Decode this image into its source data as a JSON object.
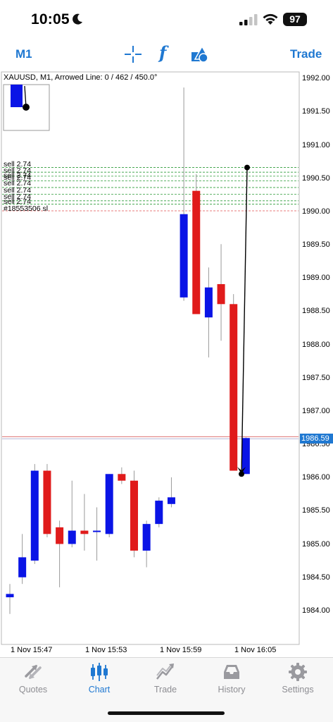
{
  "status_bar": {
    "time": "10:05",
    "battery": "97"
  },
  "toolbar": {
    "timeframe": "M1",
    "indicator_symbol": "f",
    "trade_label": "Trade",
    "icons": [
      "crosshair-icon",
      "indicators-icon",
      "objects-icon"
    ]
  },
  "chart": {
    "title": "XAUUSD, M1, Arrowed Line: 0 / 462 / 450.0°",
    "current_price": "1986.59",
    "order_lines": [
      "sell 2.74",
      "sell 2.74",
      "sell 2.74",
      "sell 2.74",
      "sell 2.74",
      "sell 2.74",
      "sell 2.74",
      "sell 2.74",
      "#18553506 sl"
    ],
    "y_ticks": [
      "1992.00",
      "1991.50",
      "1991.00",
      "1990.50",
      "1990.00",
      "1989.50",
      "1989.00",
      "1988.50",
      "1988.00",
      "1987.50",
      "1987.00",
      "1986.50",
      "1986.00",
      "1985.50",
      "1985.00",
      "1984.50",
      "1984.00"
    ],
    "x_ticks": [
      "1 Nov 15:47",
      "1 Nov 15:53",
      "1 Nov 15:59",
      "1 Nov 16:05"
    ],
    "colors": {
      "bull": "#0a14e6",
      "bear": "#e01b1b",
      "order_line": "#2e9c3a",
      "sl_line": "#e05050",
      "price_line": "#d04040",
      "accent": "#1f78d1"
    }
  },
  "chart_data": {
    "type": "candlestick",
    "symbol": "XAUUSD",
    "timeframe": "M1",
    "ylim": [
      1983.6,
      1992.1
    ],
    "current_price": 1986.59,
    "order_levels": [
      1990.65,
      1990.58,
      1990.52,
      1990.45,
      1990.35,
      1990.25,
      1990.15,
      1990.1
    ],
    "sl_level": 1990.0,
    "candles": [
      {
        "o": 1984.2,
        "h": 1984.4,
        "l": 1983.95,
        "c": 1984.25
      },
      {
        "o": 1984.5,
        "h": 1985.15,
        "l": 1984.4,
        "c": 1984.8
      },
      {
        "o": 1984.75,
        "h": 1986.2,
        "l": 1984.7,
        "c": 1986.1
      },
      {
        "o": 1986.1,
        "h": 1986.2,
        "l": 1985.1,
        "c": 1985.15
      },
      {
        "o": 1985.25,
        "h": 1985.35,
        "l": 1984.35,
        "c": 1985.0
      },
      {
        "o": 1985.0,
        "h": 1985.95,
        "l": 1984.95,
        "c": 1985.2
      },
      {
        "o": 1985.2,
        "h": 1985.75,
        "l": 1984.9,
        "c": 1985.15
      },
      {
        "o": 1985.18,
        "h": 1985.55,
        "l": 1984.75,
        "c": 1985.2
      },
      {
        "o": 1985.15,
        "h": 1986.05,
        "l": 1985.1,
        "c": 1986.05
      },
      {
        "o": 1986.05,
        "h": 1986.15,
        "l": 1985.9,
        "c": 1985.95
      },
      {
        "o": 1985.95,
        "h": 1986.1,
        "l": 1984.8,
        "c": 1984.9
      },
      {
        "o": 1984.9,
        "h": 1985.35,
        "l": 1984.65,
        "c": 1985.3
      },
      {
        "o": 1985.3,
        "h": 1985.7,
        "l": 1985.25,
        "c": 1985.65
      },
      {
        "o": 1985.6,
        "h": 1986.0,
        "l": 1985.55,
        "c": 1985.7
      },
      {
        "o": 1988.7,
        "h": 1991.85,
        "l": 1988.65,
        "c": 1989.95
      },
      {
        "o": 1990.3,
        "h": 1990.55,
        "l": 1988.45,
        "c": 1988.45
      },
      {
        "o": 1988.4,
        "h": 1989.15,
        "l": 1987.8,
        "c": 1988.85
      },
      {
        "o": 1988.9,
        "h": 1989.5,
        "l": 1988.05,
        "c": 1988.6
      },
      {
        "o": 1988.6,
        "h": 1988.75,
        "l": 1986.1,
        "c": 1986.1
      },
      {
        "o": 1986.05,
        "h": 1986.6,
        "l": 1986.05,
        "c": 1986.59
      }
    ],
    "arrowed_line": {
      "from": 1990.65,
      "to": 1986.05
    },
    "x_ticks": [
      "1 Nov 15:47",
      "1 Nov 15:53",
      "1 Nov 15:59",
      "1 Nov 16:05"
    ]
  },
  "tabs": [
    {
      "label": "Quotes",
      "icon": "quotes-icon"
    },
    {
      "label": "Chart",
      "icon": "chart-icon",
      "active": true
    },
    {
      "label": "Trade",
      "icon": "trade-icon"
    },
    {
      "label": "History",
      "icon": "history-icon"
    },
    {
      "label": "Settings",
      "icon": "settings-icon"
    }
  ]
}
